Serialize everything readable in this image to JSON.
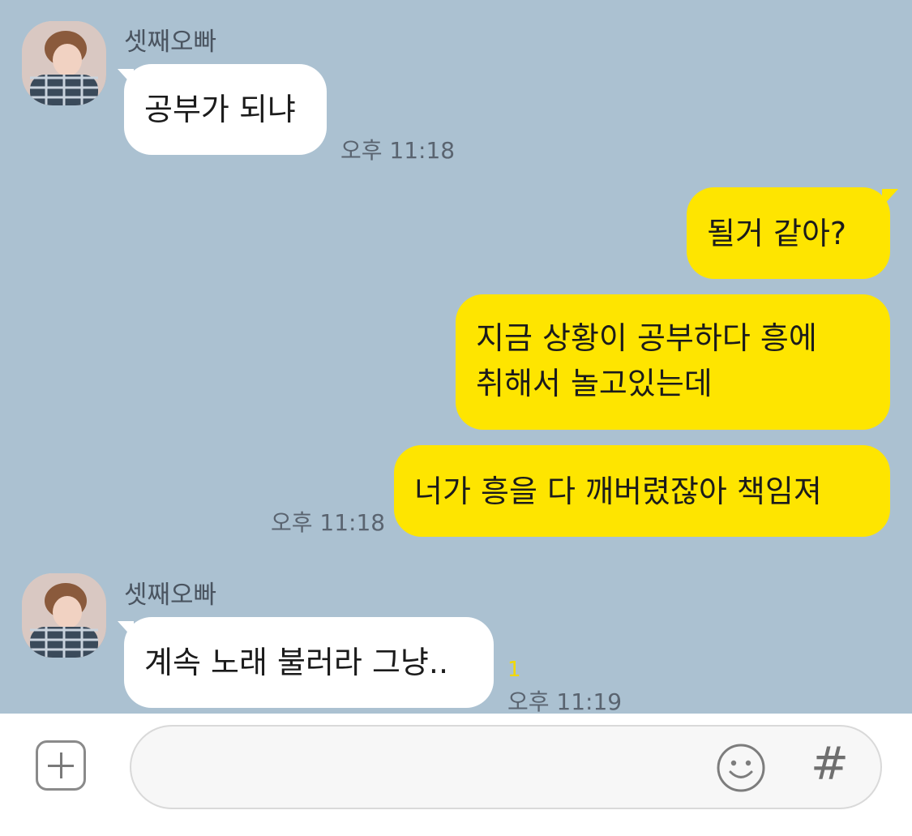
{
  "messages": {
    "first_sender": "셋째오빠",
    "m1": {
      "text": "공부가 되냐",
      "time": "오후 11:18"
    },
    "m2": {
      "text": "될거 같아?"
    },
    "m3": {
      "text": "지금 상황이 공부하다 흥에\n취해서 놀고있는데"
    },
    "m4": {
      "text": "너가 흥을 다 깨버렸잖아 책임져",
      "time": "오후 11:18"
    },
    "second_sender": "셋째오빠",
    "m5": {
      "text": "계속 노래 불러라 그냥..",
      "time": "오후 11:19",
      "unread": "1"
    }
  },
  "composer": {
    "input_value": "",
    "plus_icon": "plus-icon",
    "emoji_icon": "emoji-icon",
    "hash_label": "#"
  },
  "colors": {
    "background": "#abc1d1",
    "incoming_bubble": "#ffffff",
    "outgoing_bubble": "#fee500",
    "unread": "#f2d900"
  }
}
